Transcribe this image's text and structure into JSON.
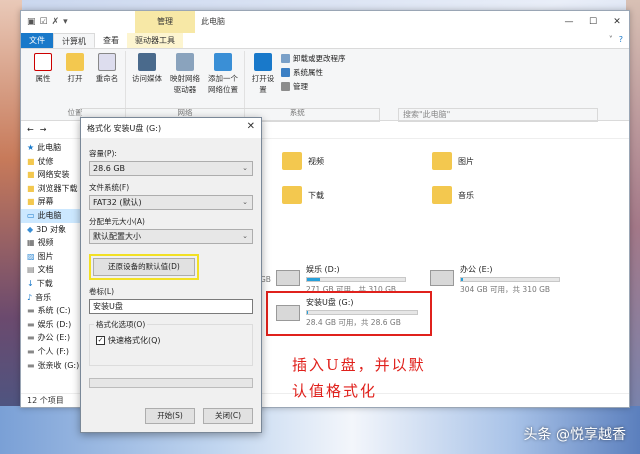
{
  "window": {
    "title": "此电脑",
    "tool_tab": "管理",
    "min": "—",
    "max": "☐",
    "close": "✕"
  },
  "ribbon_tabs": [
    "文件",
    "计算机",
    "查看",
    "驱动器工具"
  ],
  "ribbon": {
    "location": {
      "label": "位置",
      "buttons": [
        "属性",
        "打开",
        "重命名"
      ]
    },
    "network": {
      "label": "网络",
      "buttons": [
        "访问媒体",
        "映射网络驱动器",
        "添加一个网络位置"
      ]
    },
    "system": {
      "label": "系统",
      "open_settings": "打开设置",
      "items": [
        "卸载或更改程序",
        "系统属性",
        "管理"
      ]
    }
  },
  "address": {
    "path": "此电脑",
    "search_placeholder": "搜索\"此电脑\""
  },
  "nav": {
    "items": [
      "此电脑",
      "仗修",
      "网络安装",
      "浏览器下载",
      "屏幕",
      "此电脑",
      "3D 对象",
      "视频",
      "图片",
      "文档",
      "下载",
      "音乐",
      "系统 (C:)",
      "娱乐 (D:)",
      "办公 (E:)",
      "个人 (F:)",
      "张亲收 (G:)"
    ]
  },
  "folders": [
    {
      "name": "视频"
    },
    {
      "name": "图片"
    },
    {
      "name": "下载"
    },
    {
      "name": "音乐"
    }
  ],
  "drives": [
    {
      "name": "娱乐 (D:)",
      "size": "271 GB 可用，共 310 GB",
      "used": 0.13
    },
    {
      "name": "办公 (E:)",
      "size": "304 GB 可用，共 310 GB",
      "used": 0.02
    },
    {
      "name": "安装U盘 (G:)",
      "size": "28.4 GB 可用，共 28.6 GB",
      "used": 0.01
    }
  ],
  "partial_drive_text": "GB",
  "status": {
    "count": "12 个项目",
    "selected": "选"
  },
  "dialog": {
    "title": "格式化 安装U盘 (G:)",
    "capacity_label": "容量(P):",
    "capacity_value": "28.6 GB",
    "fs_label": "文件系统(F)",
    "fs_value": "FAT32 (默认)",
    "alloc_label": "分配单元大小(A)",
    "alloc_value": "默认配置大小",
    "restore_button": "还原设备的默认值(D)",
    "volume_label": "卷标(L)",
    "volume_value": "安装U盘",
    "options_label": "格式化选项(O)",
    "quick_format": "快速格式化(Q)",
    "start": "开始(S)",
    "close": "关闭(C)"
  },
  "annotation": {
    "line1": "插入U盘，并以默",
    "line2": "认值格式化"
  },
  "watermark": "头条 @悦享越香",
  "colors": {
    "accent": "#1979ca",
    "highlight_red": "#e0211c",
    "highlight_yellow": "#f2e024"
  }
}
